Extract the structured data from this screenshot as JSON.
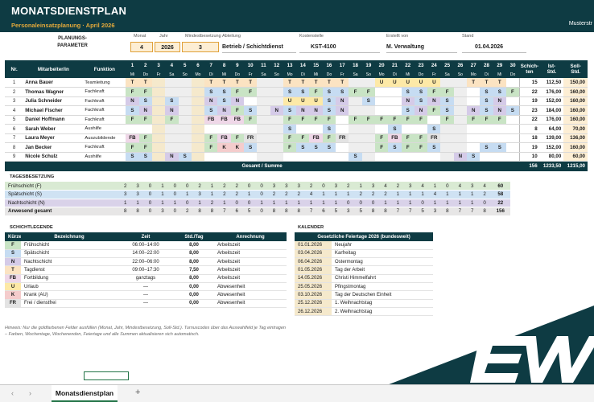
{
  "banner": {
    "title": "MONATSDIENSTPLAN",
    "subtitle": "Personaleinsatzplanung · April 2026",
    "right": "Musterstr"
  },
  "params": {
    "label1": "PLANUNGS-",
    "label2": "PARAMETER",
    "monat_h": "Monat",
    "jahr_h": "Jahr",
    "min_h": "Mindestbesetzung",
    "abt_h": "Abteilung",
    "kst_h": "Kostenstelle",
    "erst_h": "Erstellt von",
    "stand_h": "Stand",
    "monat": "4",
    "jahr": "2026",
    "min": "3",
    "abt": "Betrieb / Schichtdienst",
    "kst": "KST-4100",
    "erst": "M. Verwaltung",
    "stand": "01.04.2026"
  },
  "plan": {
    "h_nr": "Nr.",
    "h_name": "Mitarbeiter/in",
    "h_fn": "Funktion",
    "h_sch1": "Schich-",
    "h_sch2": "ten",
    "h_ist1": "Ist-",
    "h_ist2": "Std.",
    "h_soll1": "Soll-",
    "h_soll2": "Std.",
    "days": [
      "1",
      "2",
      "3",
      "4",
      "5",
      "6",
      "7",
      "8",
      "9",
      "10",
      "11",
      "12",
      "13",
      "14",
      "15",
      "16",
      "17",
      "18",
      "19",
      "20",
      "21",
      "22",
      "23",
      "24",
      "25",
      "26",
      "27",
      "28",
      "29",
      "30"
    ],
    "wd": [
      "Mi",
      "Do",
      "Fr",
      "Sa",
      "So",
      "Mo",
      "Di",
      "Mi",
      "Do",
      "Fr",
      "Sa",
      "So",
      "Mo",
      "Di",
      "Mi",
      "Do",
      "Fr",
      "Sa",
      "So",
      "Mo",
      "Di",
      "Mi",
      "Do",
      "Fr",
      "Sa",
      "So",
      "Mo",
      "Di",
      "Mi",
      "Do"
    ],
    "rows": [
      {
        "nr": "1",
        "name": "Anna Bauer",
        "fn": "Teamleitung",
        "s": [
          "T",
          "T",
          "",
          "",
          "",
          "",
          "T",
          "T",
          "T",
          "T",
          "",
          "",
          "T",
          "T",
          "T",
          "T",
          "T",
          "",
          "",
          "U",
          "U",
          "U",
          "U",
          "U",
          "",
          "",
          "T",
          "T",
          "T",
          ""
        ],
        "n": "15",
        "ist": "112,50",
        "soll": "150,00"
      },
      {
        "nr": "2",
        "name": "Thomas Wagner",
        "fn": "Fachkraft",
        "s": [
          "F",
          "F",
          "",
          "",
          "",
          "",
          "S",
          "S",
          "F",
          "F",
          "",
          "",
          "S",
          "S",
          "F",
          "S",
          "S",
          "F",
          "F",
          "",
          "",
          "S",
          "S",
          "F",
          "F",
          "",
          "",
          "S",
          "S",
          "F"
        ],
        "n": "22",
        "ist": "176,00",
        "soll": "160,00"
      },
      {
        "nr": "3",
        "name": "Julia Schneider",
        "fn": "Fachkraft",
        "s": [
          "N",
          "S",
          "",
          "S",
          "",
          "",
          "N",
          "S",
          "N",
          "",
          "",
          "",
          "U",
          "U",
          "U",
          "S",
          "N",
          "",
          "S",
          "",
          "",
          "N",
          "S",
          "N",
          "S",
          "",
          "",
          "S",
          "N",
          ""
        ],
        "n": "19",
        "ist": "152,00",
        "soll": "160,00"
      },
      {
        "nr": "4",
        "name": "Michael Fischer",
        "fn": "Fachkraft",
        "s": [
          "S",
          "N",
          "",
          "N",
          "",
          "",
          "S",
          "N",
          "F",
          "S",
          "",
          "N",
          "S",
          "N",
          "N",
          "S",
          "N",
          "",
          "",
          "",
          "",
          "S",
          "N",
          "F",
          "S",
          "",
          "N",
          "S",
          "N",
          "S"
        ],
        "n": "23",
        "ist": "184,00",
        "soll": "160,00"
      },
      {
        "nr": "5",
        "name": "Daniel Hoffmann",
        "fn": "Fachkraft",
        "s": [
          "F",
          "F",
          "",
          "F",
          "",
          "",
          "FB",
          "FB",
          "FB",
          "F",
          "",
          "",
          "F",
          "F",
          "F",
          "F",
          "",
          "F",
          "F",
          "F",
          "F",
          "F",
          "F",
          "",
          "F",
          "",
          "F",
          "F",
          "F",
          ""
        ],
        "n": "22",
        "ist": "176,00",
        "soll": "160,00"
      },
      {
        "nr": "6",
        "name": "Sarah Weber",
        "fn": "Aushilfe",
        "s": [
          "",
          "",
          "",
          "",
          "",
          "",
          "",
          "",
          "",
          "",
          "",
          "",
          "S",
          "",
          "",
          "S",
          "",
          "",
          "",
          "",
          "S",
          "",
          "",
          "S",
          "",
          "",
          "",
          "",
          "",
          ""
        ],
        "n": "8",
        "ist": "64,00",
        "soll": "70,00"
      },
      {
        "nr": "7",
        "name": "Laura Meyer",
        "fn": "Auszubildende",
        "s": [
          "FB",
          "F",
          "",
          "",
          "",
          "",
          "F",
          "FB",
          "F",
          "FR",
          "",
          "",
          "F",
          "F",
          "FB",
          "F",
          "FR",
          "",
          "",
          "F",
          "FB",
          "F",
          "F",
          "FR",
          "",
          "",
          "",
          "",
          "",
          ""
        ],
        "n": "18",
        "ist": "139,00",
        "soll": "136,00"
      },
      {
        "nr": "8",
        "name": "Jan Becker",
        "fn": "Fachkraft",
        "s": [
          "F",
          "F",
          "",
          "",
          "",
          "",
          "F",
          "K",
          "K",
          "S",
          "",
          "",
          "F",
          "S",
          "S",
          "S",
          "",
          "",
          "",
          "F",
          "S",
          "F",
          "F",
          "S",
          "",
          "",
          "",
          "S",
          "S",
          ""
        ],
        "n": "19",
        "ist": "152,00",
        "soll": "160,00"
      },
      {
        "nr": "9",
        "name": "Nicole Schulz",
        "fn": "Aushilfe",
        "s": [
          "S",
          "S",
          "",
          "N",
          "S",
          "",
          "",
          "",
          "",
          "",
          "",
          "",
          "",
          "",
          "",
          "",
          "",
          "S",
          "",
          "",
          "",
          "",
          "",
          "",
          "",
          "N",
          "S",
          "",
          "",
          ""
        ],
        "n": "10",
        "ist": "80,00",
        "soll": "60,00"
      }
    ],
    "total_label": "Gesamt / Summe",
    "total_n": "156",
    "total_ist": "1233,50",
    "total_soll": "1215,00"
  },
  "occ": {
    "title": "TAGESBESETZUNG",
    "rows": [
      {
        "label": "Frühschicht (F)",
        "v": [
          "2",
          "3",
          "0",
          "1",
          "0",
          "0",
          "2",
          "1",
          "2",
          "2",
          "0",
          "0",
          "3",
          "3",
          "3",
          "2",
          "0",
          "3",
          "2",
          "1",
          "3",
          "4",
          "2",
          "3",
          "4",
          "1",
          "0",
          "4",
          "3",
          "4"
        ],
        "sum": "60",
        "bg": "#d9ead3"
      },
      {
        "label": "Spätschicht (S)",
        "v": [
          "3",
          "3",
          "0",
          "1",
          "0",
          "1",
          "3",
          "1",
          "2",
          "2",
          "1",
          "0",
          "2",
          "2",
          "2",
          "4",
          "1",
          "1",
          "1",
          "2",
          "2",
          "2",
          "1",
          "1",
          "1",
          "4",
          "1",
          "1",
          "1",
          "2"
        ],
        "sum": "58",
        "bg": "#cfe2f3"
      },
      {
        "label": "Nachtschicht (N)",
        "v": [
          "1",
          "1",
          "0",
          "1",
          "1",
          "0",
          "1",
          "2",
          "1",
          "0",
          "0",
          "1",
          "1",
          "1",
          "1",
          "1",
          "1",
          "1",
          "0",
          "0",
          "0",
          "1",
          "1",
          "1",
          "0",
          "1",
          "1",
          "1",
          "1",
          "0"
        ],
        "sum": "22",
        "bg": "#d9d2e9"
      },
      {
        "label": "Anwesend gesamt",
        "v": [
          "8",
          "8",
          "0",
          "3",
          "0",
          "2",
          "8",
          "8",
          "7",
          "6",
          "5",
          "0",
          "8",
          "8",
          "8",
          "7",
          "6",
          "5",
          "3",
          "5",
          "8",
          "8",
          "7",
          "7",
          "5",
          "3",
          "8",
          "7",
          "7",
          "8"
        ],
        "sum": "156",
        "bg": "#e7e6e6"
      }
    ]
  },
  "legend": {
    "title": "SCHICHTLEGENDE",
    "h": [
      "Kürzel",
      "Bezeichnung",
      "Zeit",
      "Std./Tag",
      "Anrechnung"
    ],
    "rows": [
      {
        "k": "F",
        "name": "Frühschicht",
        "zeit": "06:00–14:00",
        "std": "8,00",
        "anr": "Arbeitszeit",
        "bg": "#c9e4c5"
      },
      {
        "k": "S",
        "name": "Spätschicht",
        "zeit": "14:00–22:00",
        "std": "8,00",
        "anr": "Arbeitszeit",
        "bg": "#c6dcf2"
      },
      {
        "k": "N",
        "name": "Nachtschicht",
        "zeit": "22:00–06:00",
        "std": "8,00",
        "anr": "Arbeitszeit",
        "bg": "#d5cbe8"
      },
      {
        "k": "T",
        "name": "Tagdienst",
        "zeit": "09:00–17:30",
        "std": "7,50",
        "anr": "Arbeitszeit",
        "bg": "#fbe3c2"
      },
      {
        "k": "FB",
        "name": "Fortbildung",
        "zeit": "ganztags",
        "std": "8,00",
        "anr": "Arbeitszeit",
        "bg": "#efd7e8"
      },
      {
        "k": "U",
        "name": "Urlaub",
        "zeit": "—",
        "std": "0,00",
        "anr": "Abwesenheit",
        "bg": "#fde9a7"
      },
      {
        "k": "K",
        "name": "Krank (AU)",
        "zeit": "—",
        "std": "0,00",
        "anr": "Abwesenheit",
        "bg": "#f4cccc"
      },
      {
        "k": "FR",
        "name": "Frei / dienstfrei",
        "zeit": "—",
        "std": "0,00",
        "anr": "Abwesenheit",
        "bg": "#e3e3e3"
      }
    ]
  },
  "kal": {
    "title": "KALENDER",
    "h": "Gesetzliche Feiertage 2026 (bundesweit)",
    "rows": [
      {
        "d": "01.01.2026",
        "n": "Neujahr"
      },
      {
        "d": "03.04.2026",
        "n": "Karfreitag"
      },
      {
        "d": "06.04.2026",
        "n": "Ostermontag"
      },
      {
        "d": "01.05.2026",
        "n": "Tag der Arbeit"
      },
      {
        "d": "14.05.2026",
        "n": "Christi Himmelfahrt"
      },
      {
        "d": "25.05.2026",
        "n": "Pfingstmontag"
      },
      {
        "d": "03.10.2026",
        "n": "Tag der Deutschen Einheit"
      },
      {
        "d": "25.12.2026",
        "n": "1. Weihnachtstag"
      },
      {
        "d": "26.12.2026",
        "n": "2. Weihnachtstag"
      }
    ]
  },
  "hint": "Hinweis: Nur die goldfarbenen Felder ausfüllen (Monat, Jahr, Mindestbesetzung, Soll-Std.). Turnuscodes über das Auswahlfeld je Tag eintragen – Farben, Wochentage, Wochenenden, Feiertage und alle Summen aktualisieren sich automatisch.",
  "sheet": {
    "tab": "Monatsdienstplan",
    "prev": "‹",
    "next": "›",
    "add": "+"
  },
  "colors": {
    "primary": "#0e3b43",
    "accent": "#e3a93b",
    "excel_green": "#217346"
  },
  "logo": {
    "text": "EW"
  }
}
